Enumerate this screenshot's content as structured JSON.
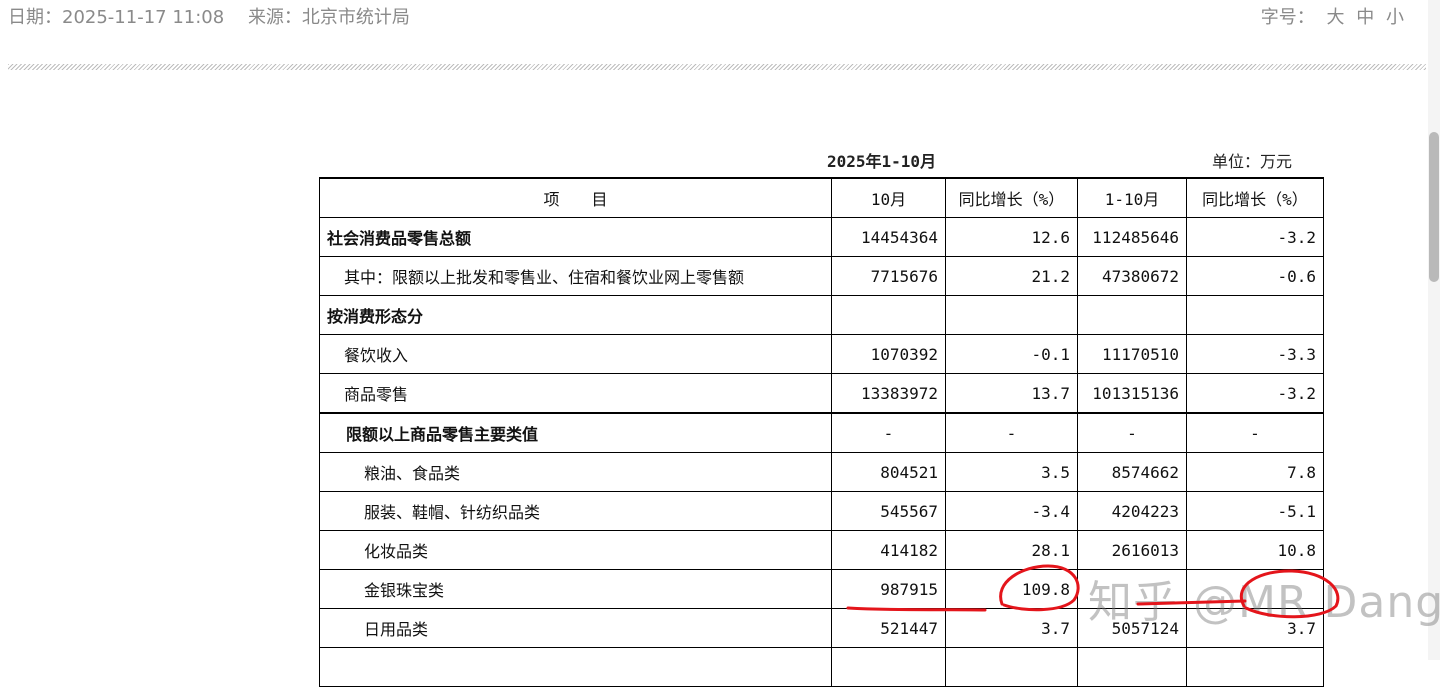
{
  "meta": {
    "date": "日期：2025-11-17 11:08",
    "source": "来源：北京市统计局",
    "font_size_label": "字号：",
    "font_size_options": [
      "大",
      "中",
      "小"
    ]
  },
  "table": {
    "period": "2025年1-10月",
    "unit": "单位：万元",
    "headers": [
      "项　　目",
      "10月",
      "同比增长（%）",
      "1-10月",
      "同比增长（%）"
    ],
    "rows": [
      {
        "label": "社会消费品零售总额",
        "values": [
          "14454364",
          "12.6",
          "112485646",
          "-3.2"
        ]
      },
      {
        "label": "其中：限额以上批发和零售业、住宿和餐饮业网上零售额",
        "values": [
          "7715676",
          "21.2",
          "47380672",
          "-0.6"
        ]
      },
      {
        "label": "按消费形态分",
        "values": [
          "",
          "",
          "",
          ""
        ]
      },
      {
        "label": "餐饮收入",
        "values": [
          "1070392",
          "-0.1",
          "11170510",
          "-3.3"
        ]
      },
      {
        "label": "商品零售",
        "values": [
          "13383972",
          "13.7",
          "101315136",
          "-3.2"
        ]
      },
      {
        "label": "限额以上商品零售主要类值",
        "values": [
          "-",
          "-",
          "-",
          "-"
        ]
      },
      {
        "label": "粮油、食品类",
        "values": [
          "804521",
          "3.5",
          "8574662",
          "7.8"
        ]
      },
      {
        "label": "服装、鞋帽、针纺织品类",
        "values": [
          "545567",
          "-3.4",
          "4204223",
          "-5.1"
        ]
      },
      {
        "label": "化妆品类",
        "values": [
          "414182",
          "28.1",
          "2616013",
          "10.8"
        ]
      },
      {
        "label": "金银珠宝类",
        "values": [
          "987915",
          "109.8",
          "",
          ""
        ]
      },
      {
        "label": "日用品类",
        "values": [
          "521447",
          "3.7",
          "5057124",
          "3.7"
        ]
      }
    ]
  },
  "watermark": "知乎 @MR Dang",
  "colors": {
    "annotation": "#e4151b",
    "meta_text": "#8a8a8a"
  }
}
